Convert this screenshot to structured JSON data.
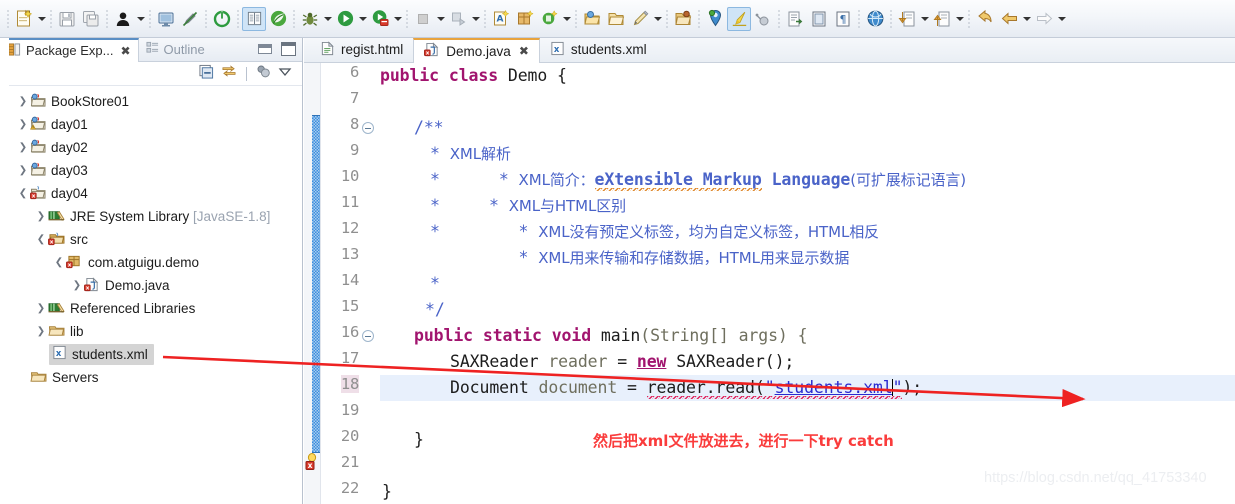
{
  "toolbar": {
    "groups": [
      {
        "items": [
          {
            "name": "new-wizard-icon",
            "glyph": "new",
            "dropdown": true
          },
          {
            "name": "separator",
            "glyph": "sep"
          },
          {
            "name": "save-icon",
            "glyph": "save",
            "dropdown": false
          },
          {
            "name": "save-all-icon",
            "glyph": "saveall",
            "dropdown": false
          },
          {
            "name": "separator",
            "glyph": "sep"
          },
          {
            "name": "print-icon",
            "glyph": "person",
            "dropdown": true
          },
          {
            "name": "separator",
            "glyph": "sep"
          },
          {
            "name": "console-icon",
            "glyph": "console",
            "dropdown": false
          },
          {
            "name": "toggle-markoccurrences-icon",
            "glyph": "pen",
            "dropdown": false
          },
          {
            "name": "separator",
            "glyph": "sep"
          },
          {
            "name": "terminate-icon",
            "glyph": "power",
            "dropdown": false
          },
          {
            "name": "separator",
            "glyph": "sep"
          },
          {
            "name": "open-type-icon",
            "glyph": "book",
            "selected": true
          },
          {
            "name": "spring-icon",
            "glyph": "leaf",
            "dropdown": false
          },
          {
            "name": "separator",
            "glyph": "sep"
          },
          {
            "name": "debug-icon",
            "glyph": "bug",
            "dropdown": true
          },
          {
            "name": "run-icon",
            "glyph": "run",
            "dropdown": true
          },
          {
            "name": "run-server-icon",
            "glyph": "runserver",
            "dropdown": true
          },
          {
            "name": "separator",
            "glyph": "sep"
          },
          {
            "name": "stop-icon",
            "glyph": "stop",
            "dropdown": true
          },
          {
            "name": "profile-icon",
            "glyph": "profile",
            "dropdown": true
          },
          {
            "name": "separator",
            "glyph": "sep"
          },
          {
            "name": "new-annotation-icon",
            "glyph": "annot",
            "dropdown": false
          },
          {
            "name": "new-package-icon",
            "glyph": "package",
            "dropdown": false
          },
          {
            "name": "new-class-icon",
            "glyph": "class",
            "dropdown": true
          },
          {
            "name": "separator",
            "glyph": "sep"
          },
          {
            "name": "new-folder-icon",
            "glyph": "folder1",
            "dropdown": false
          },
          {
            "name": "open-folder-icon",
            "glyph": "folder2",
            "dropdown": false
          },
          {
            "name": "new-file-icon",
            "glyph": "pencil",
            "dropdown": true
          },
          {
            "name": "separator",
            "glyph": "sep"
          },
          {
            "name": "project-icon",
            "glyph": "folder3",
            "dropdown": false
          },
          {
            "name": "separator",
            "glyph": "sep"
          },
          {
            "name": "search-icon",
            "glyph": "pin",
            "dropdown": false
          },
          {
            "name": "highlight-icon",
            "glyph": "brush",
            "selected": true
          },
          {
            "name": "spray-icon",
            "glyph": "spray",
            "dropdown": false
          },
          {
            "name": "separator",
            "glyph": "sep"
          },
          {
            "name": "export-icon",
            "glyph": "export",
            "dropdown": false
          },
          {
            "name": "word-wrap-icon",
            "glyph": "wrap",
            "dropdown": false
          },
          {
            "name": "show-whitespace-icon",
            "glyph": "pilcrow",
            "dropdown": false
          },
          {
            "name": "separator",
            "glyph": "sep"
          },
          {
            "name": "open-browser-icon",
            "glyph": "globe",
            "dropdown": false
          },
          {
            "name": "separator",
            "glyph": "sep"
          },
          {
            "name": "next-annotation-icon",
            "glyph": "downarrow",
            "dropdown": true
          },
          {
            "name": "previous-annotation-icon",
            "glyph": "uparrow",
            "dropdown": true
          },
          {
            "name": "separator",
            "glyph": "sep"
          },
          {
            "name": "last-edit-location-icon",
            "glyph": "backarrow2",
            "dropdown": false
          },
          {
            "name": "back-icon",
            "glyph": "back",
            "dropdown": true
          },
          {
            "name": "forward-icon",
            "glyph": "forward",
            "dropdown": true
          }
        ]
      }
    ]
  },
  "left_panel": {
    "tabs": [
      {
        "label": "Package Exp...",
        "icon": "package-explorer-icon",
        "active": true,
        "closable": true
      },
      {
        "label": "Outline",
        "icon": "outline-icon",
        "active": false,
        "closable": false
      }
    ],
    "window_buttons": [
      {
        "name": "minimize-button",
        "label": "Minimize"
      },
      {
        "name": "maximize-button",
        "label": "Maximize"
      }
    ],
    "view_toolbar": [
      {
        "name": "collapse-all-icon",
        "label": "Collapse All"
      },
      {
        "name": "link-with-editor-icon",
        "label": "Link with Editor"
      },
      {
        "name": "view-menu-filters-icon",
        "label": "Filters"
      },
      {
        "name": "view-menu-icon",
        "label": "View Menu"
      }
    ],
    "tree": [
      {
        "label": "BookStore01",
        "indent": 0,
        "twist": "collapsed",
        "icon": "java-project-icon"
      },
      {
        "label": "day01",
        "indent": 0,
        "twist": "collapsed",
        "icon": "java-project-warning-icon"
      },
      {
        "label": "day02",
        "indent": 0,
        "twist": "collapsed",
        "icon": "java-project-icon"
      },
      {
        "label": "day03",
        "indent": 0,
        "twist": "collapsed",
        "icon": "java-project-icon"
      },
      {
        "label": "day04",
        "indent": 0,
        "twist": "expanded",
        "icon": "java-project-error-icon"
      },
      {
        "label": "JRE System Library",
        "suffix": "[JavaSE-1.8]",
        "indent": 1,
        "twist": "collapsed",
        "icon": "library-icon"
      },
      {
        "label": "src",
        "indent": 1,
        "twist": "expanded",
        "icon": "source-folder-error-icon"
      },
      {
        "label": "com.atguigu.demo",
        "indent": 2,
        "twist": "expanded",
        "icon": "package-error-icon"
      },
      {
        "label": "Demo.java",
        "indent": 3,
        "twist": "collapsed",
        "icon": "java-file-error-icon"
      },
      {
        "label": "Referenced Libraries",
        "indent": 1,
        "twist": "collapsed",
        "icon": "library-icon"
      },
      {
        "label": "lib",
        "indent": 1,
        "twist": "collapsed",
        "icon": "folder-icon"
      },
      {
        "label": "students.xml",
        "indent": 1,
        "twist": "none",
        "icon": "xml-file-icon",
        "selected": true
      },
      {
        "label": "Servers",
        "indent": 0,
        "twist": "none",
        "icon": "folder-icon"
      }
    ]
  },
  "editor": {
    "tabs": [
      {
        "label": "regist.html",
        "icon": "html-file-icon",
        "active": false,
        "closable": false
      },
      {
        "label": "Demo.java",
        "icon": "java-file-error-icon",
        "active": true,
        "closable": true
      },
      {
        "label": "students.xml",
        "icon": "xml-file-icon",
        "active": false,
        "closable": false
      }
    ],
    "lines": [
      {
        "n": 6,
        "fold": false,
        "changed": false
      },
      {
        "n": 7,
        "fold": false,
        "changed": false
      },
      {
        "n": 8,
        "fold": true,
        "changed": true
      },
      {
        "n": 9,
        "fold": false,
        "changed": true
      },
      {
        "n": 10,
        "fold": false,
        "changed": true
      },
      {
        "n": 11,
        "fold": false,
        "changed": true
      },
      {
        "n": 12,
        "fold": false,
        "changed": true
      },
      {
        "n": 13,
        "fold": false,
        "changed": true
      },
      {
        "n": 14,
        "fold": false,
        "changed": true
      },
      {
        "n": 15,
        "fold": false,
        "changed": true
      },
      {
        "n": 16,
        "fold": true,
        "changed": true
      },
      {
        "n": 17,
        "fold": false,
        "changed": true
      },
      {
        "n": 18,
        "fold": false,
        "changed": true,
        "marker": "error-quickfix",
        "highlighted": true
      },
      {
        "n": 19,
        "fold": false,
        "changed": true
      },
      {
        "n": 20,
        "fold": false,
        "changed": true
      },
      {
        "n": 21,
        "fold": false,
        "changed": false
      },
      {
        "n": 22,
        "fold": false,
        "changed": false
      }
    ],
    "code": {
      "l6_public": "public",
      "l6_class": "class",
      "l6_name": "Demo {",
      "l8": "/**",
      "l9_star": "*",
      "l9_text": "XML解析",
      "l10_star": "*",
      "l10_bullet": "*",
      "l10_a": "XML简介：",
      "l10_b": "eXtensible Markup",
      "l10_c": "Language",
      "l10_d": "(可扩展标记语言)",
      "l11_star": "*",
      "l11_bullet": "*",
      "l11_text": "XML与HTML区别",
      "l12_star": "*",
      "l12_bullet": "*",
      "l12_text": "XML没有预定义标签，均为自定义标签，HTML相反",
      "l13_bullet": "*",
      "l13_text": "XML用来传输和存储数据，HTML用来显示数据",
      "l14": "*",
      "l15": "*/",
      "l16_public": "public",
      "l16_static": "static",
      "l16_void": "void",
      "l16_main": "main",
      "l16_args": "(String[] args) {",
      "l17_type": "SAXReader ",
      "l17_var": "reader",
      "l17_eq": " = ",
      "l17_new": "new",
      "l17_ctor": " SAXReader();",
      "l18_type": "Document ",
      "l18_var": "document",
      "l18_eq": " = ",
      "l18_call": "reader.read(",
      "l18_quote1": "\"",
      "l18_str": "students.xml",
      "l18_quote2": "\"",
      "l18_end": ");",
      "l20": "}",
      "l22": "}"
    }
  },
  "annotations": {
    "note_text": "然后把xml文件放进去，进行一下try catch",
    "note_color": "#fa3c3c",
    "arrow_color": "#ee2222",
    "arrow_from_label": "students.xml",
    "arrow_to_label": "read-argument"
  },
  "watermark": {
    "text": "https://blog.csdn.net/qq_41753340"
  },
  "colors": {
    "keyword": "#a1146e",
    "comment": "#4a63c8",
    "string": "#2b2bd0",
    "line_number": "#8f8f8f",
    "selection": "#e8f0fc",
    "tree_selection": "#d4d4d4",
    "accent_tab": "#e8a33d",
    "change_bar": "#3c8dde"
  }
}
